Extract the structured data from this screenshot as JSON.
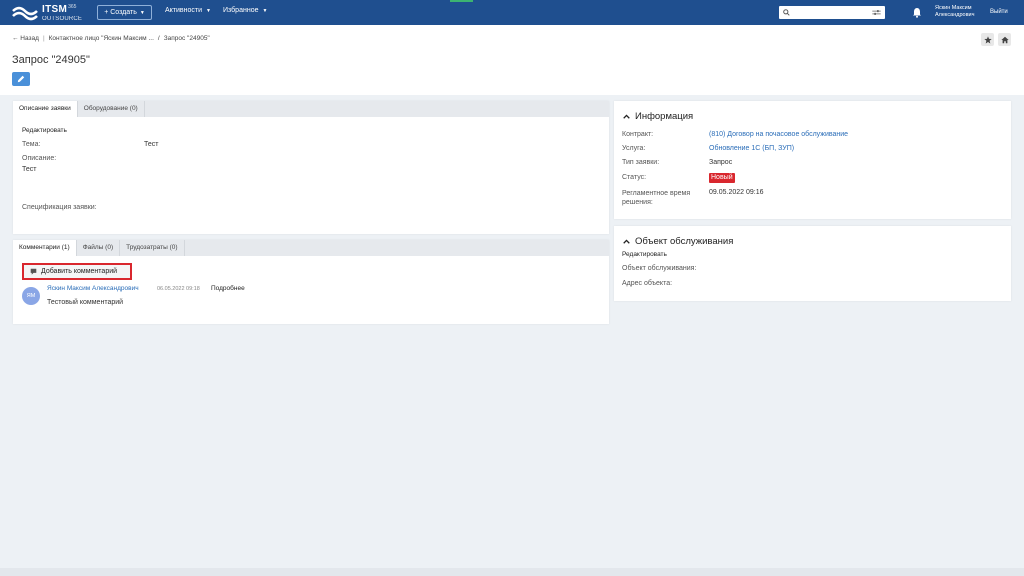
{
  "topbar": {
    "logo_main": "ITSM",
    "logo_sup": "365",
    "logo_sub": "OUTSOURCE",
    "create_label": "+ Создать",
    "activities_label": "Активности",
    "favorites_label": "Избранное",
    "search_placeholder": "",
    "user_name_line1": "Яскин Максим",
    "user_name_line2": "Александрович",
    "logout_label": "Выйти",
    "bg_color": "#1f4f8f"
  },
  "breadcrumb": {
    "back_label": "← Назад",
    "item1": "Контактное лицо \"Яскин Максим ...",
    "separator": "/",
    "item2": "Запрос \"24905\""
  },
  "page_title": "Запрос \"24905\"",
  "description_panel": {
    "tabs": [
      "Описание заявки",
      "Оборудование (0)"
    ],
    "edit_label": "Редактировать",
    "subject_label": "Тема:",
    "subject_value": "Тест",
    "description_label": "Описание:",
    "description_value": "Тест",
    "spec_label": "Спецификация заявки:"
  },
  "comments_panel": {
    "tabs": [
      "Комментарии (1)",
      "Файлы (0)",
      "Трудозатраты (0)"
    ],
    "add_comment_label": "Добавить комментарий",
    "comment": {
      "avatar_initials": "ЯМ",
      "author": "Яскин Максим Александрович",
      "datetime": "06.05.2022 09:18",
      "more_label": "Подробнее",
      "text": "Тестовый комментарий"
    }
  },
  "info_panel": {
    "title": "Информация",
    "contract_label": "Контракт:",
    "contract_value": "(810) Договор на почасовое обслуживание",
    "service_label": "Услуга:",
    "service_value": "Обновление 1С (БП, ЗУП)",
    "type_label": "Тип заявки:",
    "type_value": "Запрос",
    "status_label": "Статус:",
    "status_value": "Новый",
    "deadline_label_line1": "Регламентное время",
    "deadline_label_line2": "решения:",
    "deadline_value": "09.05.2022 09:16",
    "status_color": "#d9272e"
  },
  "service_object_panel": {
    "title": "Объект обслуживания",
    "edit_label": "Редактировать",
    "object_label": "Объект обслуживания:",
    "address_label": "Адрес объекта:"
  }
}
